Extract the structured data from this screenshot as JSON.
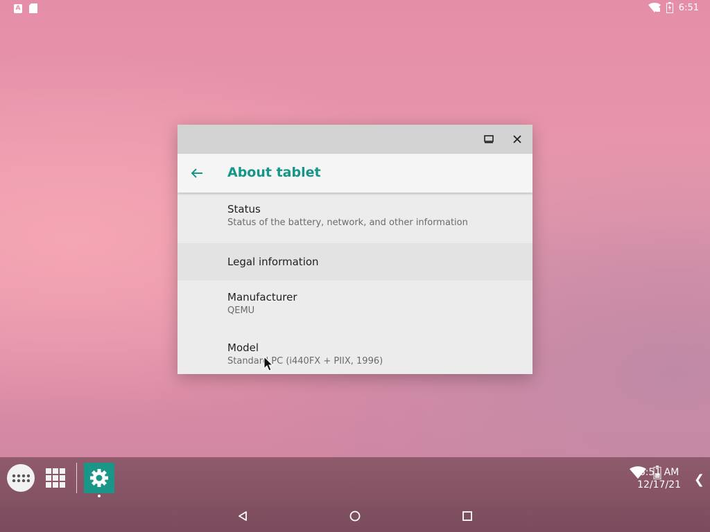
{
  "status_bar": {
    "left_icons": [
      "a-notification-icon",
      "sd-card-icon"
    ],
    "notification_letter": "A",
    "right_icons": [
      "wifi-icon",
      "battery-icon"
    ],
    "time": "6:51"
  },
  "window": {
    "controls": [
      "maximize-icon",
      "close-icon"
    ],
    "app_bar": {
      "back_icon": "arrow-back-icon",
      "title": "About tablet"
    },
    "items": [
      {
        "title": "Status",
        "subtitle": "Status of the battery, network, and other information"
      },
      {
        "title": "Legal information"
      },
      {
        "title": "Manufacturer",
        "subtitle": "QEMU"
      },
      {
        "title": "Model",
        "subtitle": "Standard PC (i440FX + PIIX, 1996)"
      }
    ]
  },
  "taskbar": {
    "apps_icon": "app-drawer-icon",
    "grid_icon": "grid-icon",
    "pinned_app_icon": "settings-gear-icon",
    "tray_icons": [
      "wifi-icon",
      "battery-icon"
    ],
    "clock_time": "6:51 AM",
    "clock_date": "12/17/21",
    "chevron": "❮"
  },
  "nav_bar": {
    "buttons": [
      "back-triangle-icon",
      "home-circle-icon",
      "recents-square-icon"
    ]
  },
  "colors": {
    "accent": "#159688",
    "taskbar": "#8f5b6c",
    "window_bg": "#ececec"
  }
}
